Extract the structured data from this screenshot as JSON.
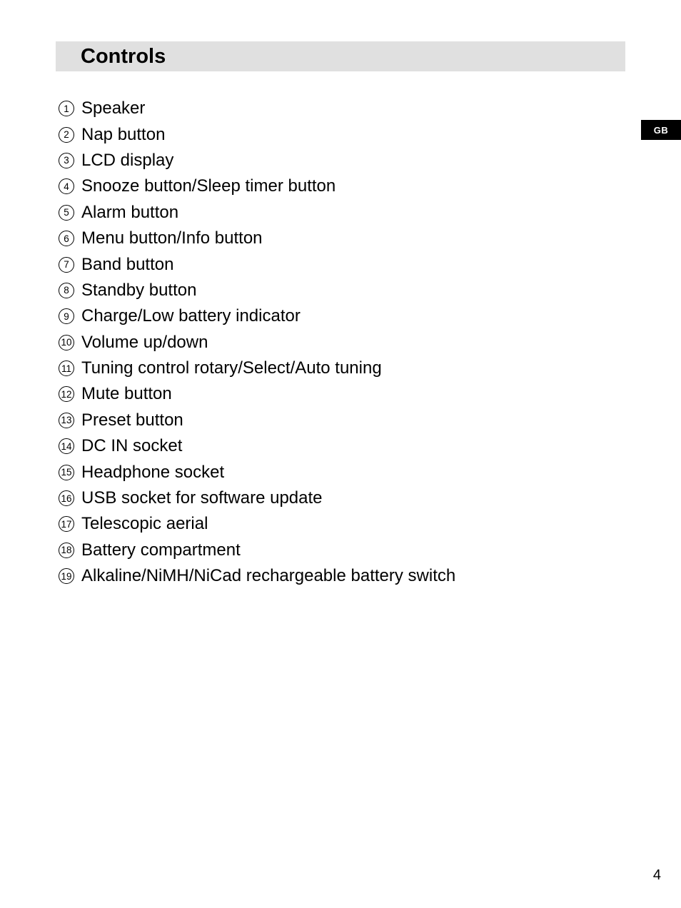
{
  "heading": "Controls",
  "language_tab": "GB",
  "page_number": "4",
  "items": [
    {
      "n": "1",
      "label": "Speaker"
    },
    {
      "n": "2",
      "label": "Nap button"
    },
    {
      "n": "3",
      "label": "LCD display"
    },
    {
      "n": "4",
      "label": "Snooze button/Sleep timer button"
    },
    {
      "n": "5",
      "label": "Alarm button"
    },
    {
      "n": "6",
      "label": "Menu button/Info button"
    },
    {
      "n": "7",
      "label": "Band button"
    },
    {
      "n": "8",
      "label": "Standby button"
    },
    {
      "n": "9",
      "label": "Charge/Low battery indicator"
    },
    {
      "n": "10",
      "label": "Volume up/down"
    },
    {
      "n": "11",
      "label": "Tuning control rotary/Select/Auto tuning"
    },
    {
      "n": "12",
      "label": "Mute button"
    },
    {
      "n": "13",
      "label": "Preset button"
    },
    {
      "n": "14",
      "label": "DC IN socket"
    },
    {
      "n": "15",
      "label": "Headphone socket"
    },
    {
      "n": "16",
      "label": "USB socket for software update"
    },
    {
      "n": "17",
      "label": "Telescopic aerial"
    },
    {
      "n": "18",
      "label": "Battery compartment"
    },
    {
      "n": "19",
      "label": "Alkaline/NiMH/NiCad rechargeable battery switch"
    }
  ]
}
